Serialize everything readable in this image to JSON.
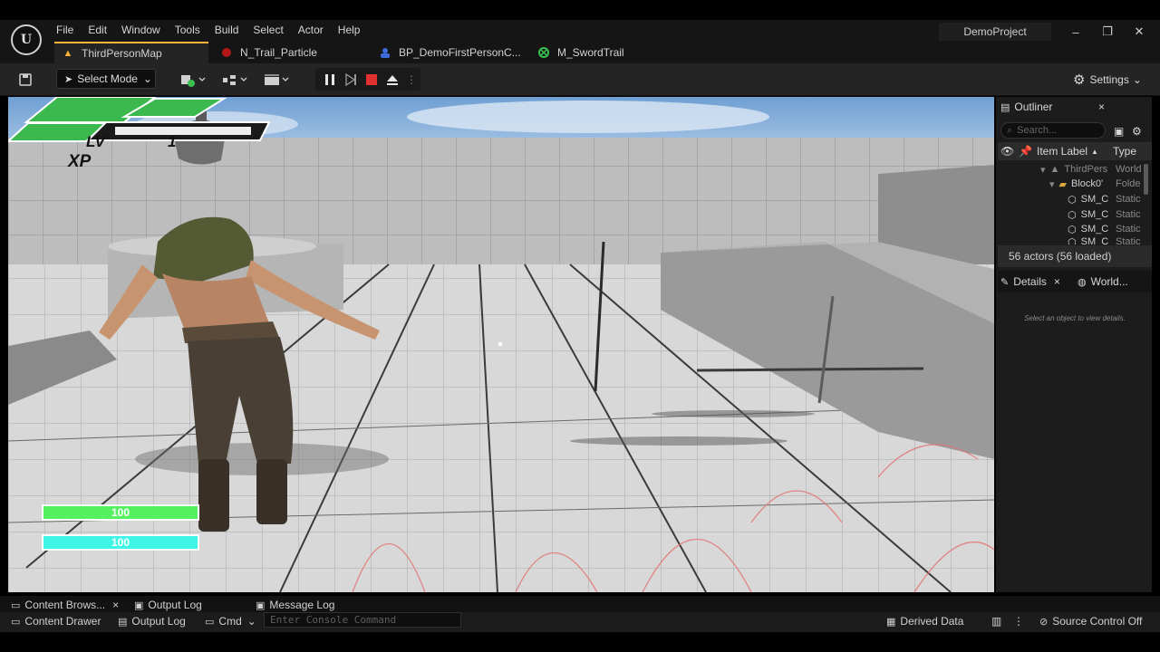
{
  "app": {
    "logo_letter": "U",
    "project_name": "DemoProject",
    "menu": [
      "File",
      "Edit",
      "Window",
      "Tools",
      "Build",
      "Select",
      "Actor",
      "Help"
    ],
    "window_controls": {
      "minimize": "–",
      "restore": "❐",
      "close": "✕"
    }
  },
  "tabs": [
    {
      "label": "ThirdPersonMap",
      "icon": "level-icon",
      "active": true
    },
    {
      "label": "N_Trail_Particle",
      "icon": "niagara-icon",
      "active": false
    },
    {
      "label": "BP_DemoFirstPersonC...",
      "icon": "blueprint-icon",
      "active": false
    },
    {
      "label": "M_SwordTrail",
      "icon": "material-icon",
      "active": false
    }
  ],
  "toolbar": {
    "select_mode_label": "Select Mode",
    "settings_label": "Settings"
  },
  "hud": {
    "lv_label": "LV",
    "lv_value": "1",
    "xp_label": "XP",
    "xp_fraction": 0.0,
    "health_value": "100",
    "stamina_value": "100",
    "health_color": "#55f060",
    "stamina_color": "#3ef5e6"
  },
  "outliner": {
    "title": "Outliner",
    "search_placeholder": "Search...",
    "col_item_label": "Item Label",
    "col_type": "Type",
    "rows": [
      {
        "label": "ThirdPers",
        "type": "World"
      },
      {
        "label": "Block0'",
        "type": "Folde"
      },
      {
        "label": "SM_C",
        "type": "Static"
      },
      {
        "label": "SM_C",
        "type": "Static"
      },
      {
        "label": "SM_C",
        "type": "Static"
      },
      {
        "label": "SM_C",
        "type": "Static"
      }
    ],
    "actors_count": "56 actors (56 loaded)"
  },
  "details": {
    "tab_details": "Details",
    "tab_world": "World...",
    "empty_message": "Select an object to view details."
  },
  "bottom": {
    "content_browser": "Content Brows...",
    "output_log_tab": "Output Log",
    "message_log": "Message Log",
    "content_drawer": "Content Drawer",
    "output_log": "Output Log",
    "cmd": "Cmd",
    "console_placeholder": "Enter Console Command",
    "derived_data": "Derived Data",
    "source_control": "Source Control Off"
  },
  "colors": {
    "accent": "#ffb238",
    "play_stop": "#e03030",
    "panel_bg": "#1c1c1c"
  }
}
